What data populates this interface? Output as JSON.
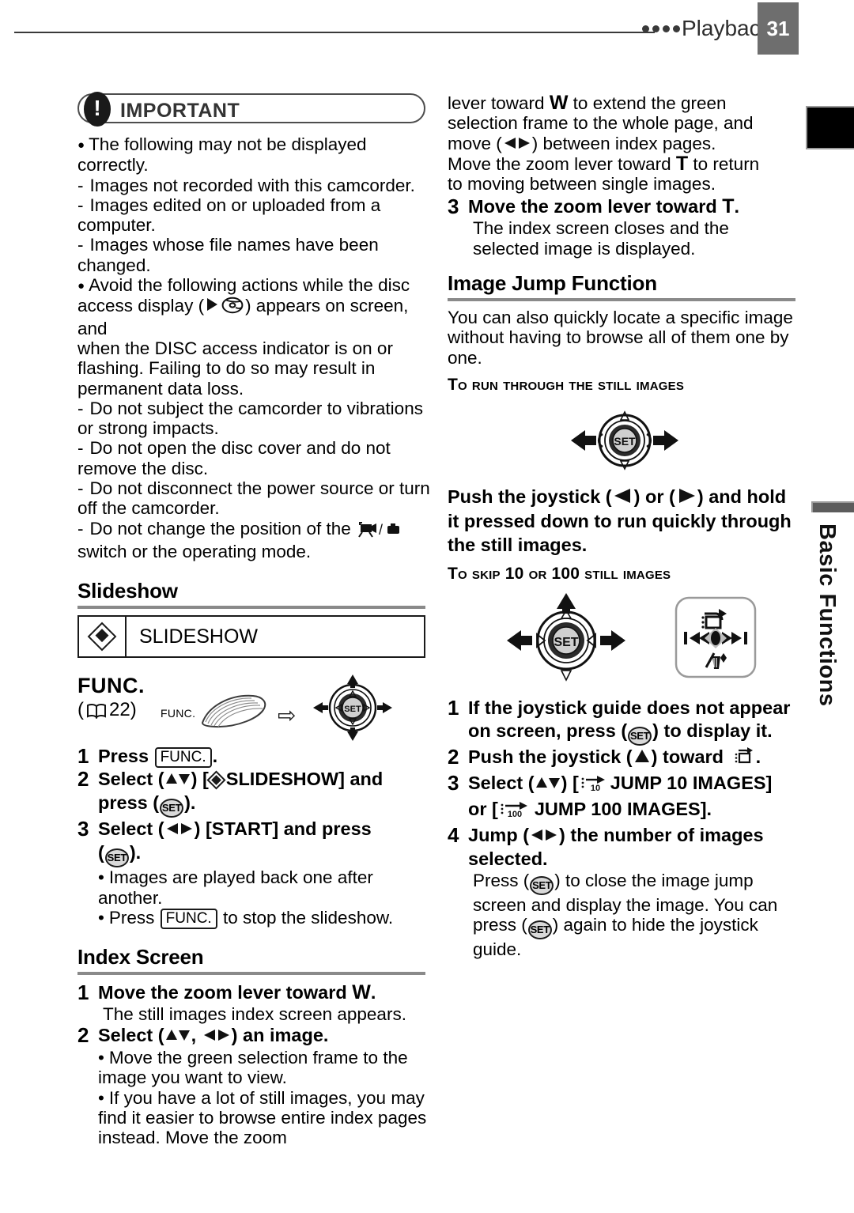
{
  "header": {
    "section": "Playback",
    "page_number": "31",
    "dots_count": 4
  },
  "side_tab": {
    "label": "Basic Functions"
  },
  "left_column": {
    "important": {
      "badge_label": "IMPORTANT",
      "icon": "exclamation-icon",
      "notes": [
        {
          "type": "bullet",
          "text": "The following may not be displayed correctly."
        },
        {
          "type": "dash",
          "text": "Images not recorded with this camcorder."
        },
        {
          "type": "dash",
          "text": "Images edited on or uploaded from a computer."
        },
        {
          "type": "dash",
          "text": "Images whose file names have been changed."
        },
        {
          "type": "bullet",
          "text": "Avoid the following actions while the disc access display (▶ disc) appears on screen, and when the DISC access indicator is on or flashing. Failing to do so may result in permanent data loss."
        },
        {
          "type": "dash",
          "text": "Do not subject the camcorder to vibrations or strong impacts."
        },
        {
          "type": "dash",
          "text": "Do not open the disc cover and do not remove the disc."
        },
        {
          "type": "dash",
          "text": "Do not disconnect the power source or turn off the camcorder."
        },
        {
          "type": "dash",
          "text": "Do not change the position of the camera/photo switch or the operating mode."
        }
      ],
      "note_5_part_a": "Avoid the following actions while the disc",
      "note_5_part_b": ") appears on screen, and",
      "note_5_part_c": "when the DISC access indicator is on or",
      "note_5_part_d": "flashing. Failing to do so may result in",
      "note_5_part_e": "permanent data loss.",
      "note_5_lead": "access display ("
    },
    "slideshow": {
      "heading": "Slideshow",
      "menu_row": {
        "icon": "slideshow-icon",
        "label": "SLIDESHOW"
      },
      "func": {
        "title": "FUNC.",
        "ref_open": "(",
        "ref_page": "22)",
        "button_label": "FUNC.",
        "arrow": "⇨",
        "set_label": "SET"
      },
      "steps": [
        {
          "num": "1",
          "prefix": "Press ",
          "key": "FUNC.",
          "suffix": "."
        },
        {
          "num": "2",
          "line1_a": "Select (",
          "line1_b": ") [",
          "line1_c": "SLIDESHOW] and",
          "line2_a": "press (",
          "line2_b": ")."
        },
        {
          "num": "3",
          "line1_a": "Select (",
          "line1_b": ") [START] and press",
          "line2_a": "(",
          "line2_b": ")."
        }
      ],
      "step3_bullets": [
        "Images are played back one after another.",
        "Press FUNC. to stop the slideshow."
      ],
      "step3_bullet2_pre": "Press ",
      "step3_bullet2_key": "FUNC.",
      "step3_bullet2_post": " to stop the slideshow."
    },
    "index_screen": {
      "heading": "Index Screen",
      "step1_num": "1",
      "step1_text_a": "Move the zoom lever toward ",
      "step1_text_w": "W",
      "step1_text_b": ".",
      "step1_sub": "The still images index screen appears.",
      "step2_num": "2",
      "step2_a": "Select (",
      "step2_b": ", ",
      "step2_c": ") an image.",
      "step2_bullets": [
        "Move the green selection frame to the image you want to view.",
        "If you have a lot of still images, you may find it easier to browse entire index pages instead. Move the zoom"
      ]
    }
  },
  "right_column": {
    "continued": {
      "line1_a": "lever toward ",
      "line1_w": "W",
      "line1_b": " to extend the green",
      "line2": "selection frame to the whole page, and",
      "line3_a": "move (",
      "line3_b": ") between index pages.",
      "line4_a": "Move the zoom lever toward ",
      "line4_t": "T",
      "line4_b": " to return",
      "line5": "to moving between single images."
    },
    "step3": {
      "num": "3",
      "text_a": "Move the zoom lever toward ",
      "text_t": "T",
      "text_b": ".",
      "sub_line1": "The index screen closes and the",
      "sub_line2": "selected image is displayed."
    },
    "image_jump": {
      "heading": "Image Jump Function",
      "intro": "You can also quickly locate a specific image without having to browse all of them one by one.",
      "sub_heading_1": "To run through the still images",
      "joystick_1": {
        "set_label": "SET",
        "arrows": [
          "left",
          "right"
        ]
      },
      "bold_para_a": "Push the joystick (",
      "bold_para_b": ") or (",
      "bold_para_c": ") and hold",
      "bold_para_d": "it pressed down to run quickly through",
      "bold_para_e": "the still images.",
      "sub_heading_2": "To skip 10 or 100 still images",
      "joystick_2": {
        "set_label": "SET",
        "arrows": [
          "up",
          "left",
          "right"
        ]
      },
      "guide_box": {
        "top_icon": "image-jump-icon",
        "left_icon": "skip-back-icon",
        "right_icon": "skip-forward-icon",
        "bottom_icon": "delete-icon",
        "center_icon": "joystick-center-icon"
      },
      "steps": [
        {
          "num": "1",
          "line1_a": "If the joystick guide does not appear",
          "line2_a": "on screen, press (",
          "line2_b": ") to display it."
        },
        {
          "num": "2",
          "line1_a": "Push the joystick (",
          "line1_b": ") toward ",
          "line1_c": "."
        },
        {
          "num": "3",
          "line1_a": "Select (",
          "line1_b": ") [",
          "line1_c": "JUMP 10 IMAGES]",
          "line2_a": "or [",
          "line2_b": "JUMP 100 IMAGES]."
        },
        {
          "num": "4",
          "line1_a": "Jump (",
          "line1_b": ") the number of images",
          "line2_a": "selected."
        }
      ],
      "closing": {
        "line1_a": "Press (",
        "line1_b": ") to close the image jump",
        "line2": "screen and display the image. You can",
        "line3_a": "press (",
        "line3_b": ") again to hide the joystick",
        "line4": "guide."
      }
    }
  },
  "colors": {
    "page_box_bg": "#6e6e6e",
    "rule_gray": "#8a8a8a",
    "set_button_fill": "#d9d9d9",
    "ink": "#000000"
  }
}
